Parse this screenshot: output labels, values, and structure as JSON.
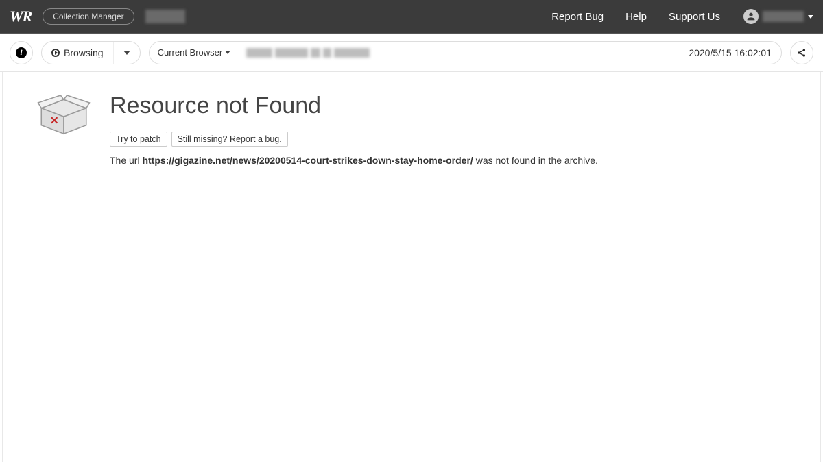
{
  "header": {
    "logo_text": "WR",
    "collection_manager": "Collection Manager",
    "links": {
      "report_bug": "Report Bug",
      "help": "Help",
      "support_us": "Support Us"
    }
  },
  "toolbar": {
    "mode_label": "Browsing",
    "browser_label": "Current Browser",
    "timestamp": "2020/5/15 16:02:01"
  },
  "page": {
    "title": "Resource not Found",
    "btn_patch": "Try to patch",
    "btn_report": "Still missing? Report a bug.",
    "msg_prefix": "The url ",
    "msg_url": "https://gigazine.net/news/20200514-court-strikes-down-stay-home-order/",
    "msg_suffix": " was not found in the archive."
  }
}
